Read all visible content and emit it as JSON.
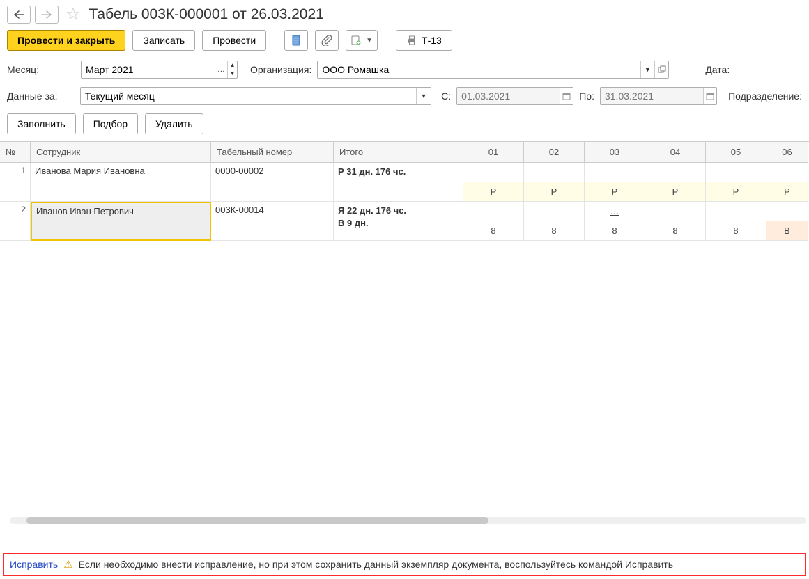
{
  "title": "Табель 003К-000001 от 26.03.2021",
  "toolbar": {
    "post_close": "Провести и закрыть",
    "save": "Записать",
    "post": "Провести",
    "print_t13": "Т-13"
  },
  "fields": {
    "month_label": "Месяц:",
    "month_value": "Март 2021",
    "org_label": "Организация:",
    "org_value": "ООО Ромашка",
    "date_label": "Дата:",
    "data_for_label": "Данные за:",
    "data_for_value": "Текущий месяц",
    "from_label": "С:",
    "from_value": "01.03.2021",
    "to_label": "По:",
    "to_value": "31.03.2021",
    "dept_label": "Подразделение:"
  },
  "actions": {
    "fill": "Заполнить",
    "pick": "Подбор",
    "delete": "Удалить"
  },
  "columns": {
    "num": "№",
    "employee": "Сотрудник",
    "tab_num": "Табельный номер",
    "total": "Итого",
    "d01": "01",
    "d02": "02",
    "d03": "03",
    "d04": "04",
    "d05": "05",
    "d06": "06"
  },
  "rows": [
    {
      "n": "1",
      "name": "Иванова Мария Ивановна",
      "tab": "0000-00002",
      "total": "Р 31 дн. 176 чс.",
      "top": [
        "",
        "",
        "",
        "",
        "",
        ""
      ],
      "bot": [
        "Р",
        "Р",
        "Р",
        "Р",
        "Р",
        "Р"
      ],
      "bot_style": "y"
    },
    {
      "n": "2",
      "name": "Иванов Иван Петрович",
      "tab": "003К-00014",
      "total": "Я 22 дн. 176 чс.\nВ 9 дн.",
      "top": [
        "",
        "",
        "…",
        "",
        "",
        ""
      ],
      "bot": [
        "8",
        "8",
        "8",
        "8",
        "8",
        "В"
      ],
      "bot_style": "",
      "last_o": true,
      "selected": true
    }
  ],
  "footer": {
    "link": "Исправить",
    "text": "Если необходимо внести исправление, но при этом сохранить данный экземпляр документа, воспользуйтесь командой Исправить"
  }
}
